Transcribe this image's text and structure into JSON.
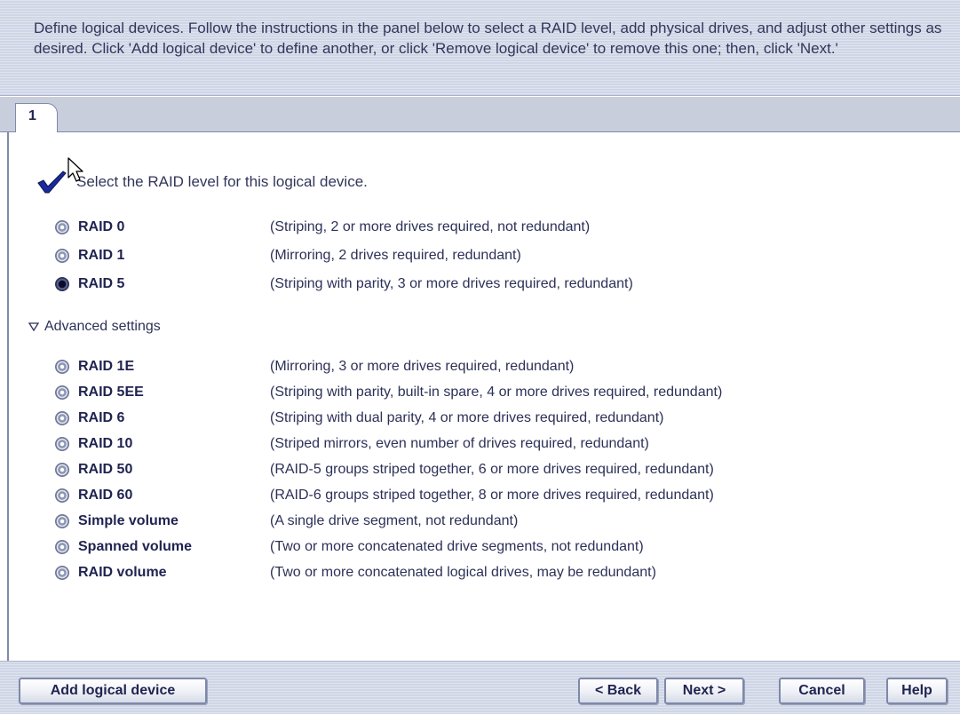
{
  "instructions": "Define logical devices.  Follow the instructions in the panel below to select a RAID level, add physical drives, and adjust other settings as desired.  Click 'Add logical device' to define another, or click 'Remove logical device' to remove this one; then, click 'Next.'",
  "tabs": [
    {
      "label": "1"
    }
  ],
  "prompt": {
    "icon": "checkmark-icon",
    "text": "Select the RAID level for this logical device."
  },
  "primary_levels": [
    {
      "name": "RAID 0",
      "desc": "(Striping, 2 or more drives required, not redundant)",
      "selected": false
    },
    {
      "name": "RAID 1",
      "desc": "(Mirroring, 2 drives required, redundant)",
      "selected": false
    },
    {
      "name": "RAID 5",
      "desc": "(Striping with parity, 3 or more drives required, redundant)",
      "selected": true
    }
  ],
  "advanced": {
    "label": "Advanced settings",
    "expanded": true
  },
  "advanced_levels": [
    {
      "name": "RAID 1E",
      "desc": "(Mirroring, 3 or more drives required, redundant)"
    },
    {
      "name": "RAID 5EE",
      "desc": "(Striping with parity, built-in spare, 4 or more drives required, redundant)"
    },
    {
      "name": "RAID 6",
      "desc": "(Striping with dual parity, 4 or more drives required, redundant)"
    },
    {
      "name": "RAID 10",
      "desc": "(Striped mirrors, even number of drives required, redundant)"
    },
    {
      "name": "RAID 50",
      "desc": "(RAID-5 groups striped together, 6 or more drives required, redundant)"
    },
    {
      "name": "RAID 60",
      "desc": "(RAID-6 groups striped together, 8 or more drives required, redundant)"
    },
    {
      "name": "Simple volume",
      "desc": "(A single drive segment, not redundant)"
    },
    {
      "name": "Spanned volume",
      "desc": "(Two or more concatenated drive segments, not redundant)"
    },
    {
      "name": "RAID volume",
      "desc": "(Two or more concatenated logical drives, may be redundant)"
    }
  ],
  "buttons": {
    "add_logical_device": "Add logical device",
    "back": "< Back",
    "next": "Next >",
    "cancel": "Cancel",
    "help": "Help"
  },
  "colors": {
    "accent": "#1f2350",
    "chrome": "#cfd6e6",
    "check": "#1a2a9c"
  }
}
